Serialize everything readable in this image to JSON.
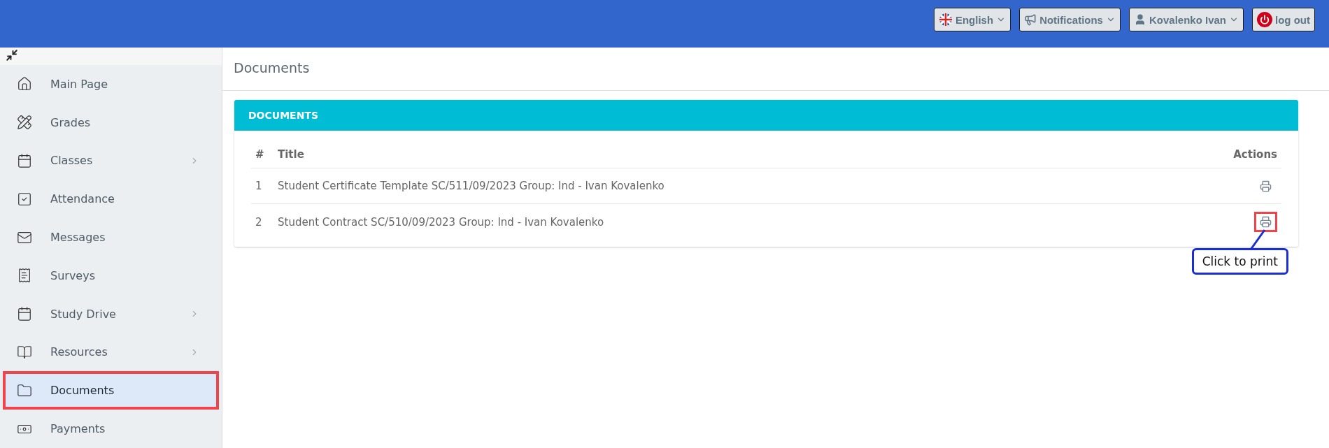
{
  "header": {
    "buttons": [
      {
        "kind": "language",
        "label": "English"
      },
      {
        "kind": "notifications",
        "label": "Notifications"
      },
      {
        "kind": "user",
        "label": "Kovalenko Ivan"
      },
      {
        "kind": "logout",
        "label": "log out"
      }
    ]
  },
  "sidebar": {
    "items": [
      {
        "label": "Main Page",
        "has_submenu": false,
        "selected": false,
        "highlighted": false
      },
      {
        "label": "Grades",
        "has_submenu": false,
        "selected": false,
        "highlighted": false
      },
      {
        "label": "Classes",
        "has_submenu": true,
        "selected": false,
        "highlighted": false
      },
      {
        "label": "Attendance",
        "has_submenu": false,
        "selected": false,
        "highlighted": false
      },
      {
        "label": "Messages",
        "has_submenu": false,
        "selected": false,
        "highlighted": false
      },
      {
        "label": "Surveys",
        "has_submenu": false,
        "selected": false,
        "highlighted": false
      },
      {
        "label": "Study Drive",
        "has_submenu": true,
        "selected": false,
        "highlighted": false
      },
      {
        "label": "Resources",
        "has_submenu": true,
        "selected": false,
        "highlighted": false
      },
      {
        "label": "Documents",
        "has_submenu": false,
        "selected": true,
        "highlighted": true
      },
      {
        "label": "Payments",
        "has_submenu": false,
        "selected": false,
        "highlighted": false
      }
    ]
  },
  "page_title": "Documents",
  "card": {
    "title": "DOCUMENTS",
    "columns": [
      "#",
      "Title",
      "Actions"
    ],
    "rows": [
      {
        "number": "1",
        "title": "Student Certificate Template SC/511/09/2023 Group: Ind - Ivan Kovalenko",
        "highlighted": false
      },
      {
        "number": "2",
        "title": "Student Contract SC/510/09/2023 Group: Ind - Ivan Kovalenko",
        "highlighted": true,
        "callout": "Click to print"
      }
    ]
  }
}
